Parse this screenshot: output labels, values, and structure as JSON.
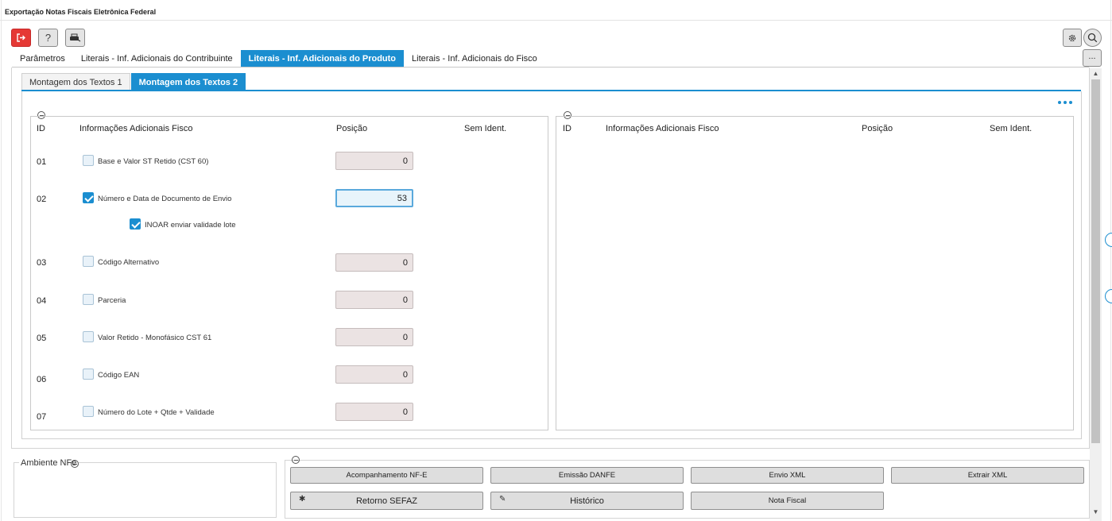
{
  "window": {
    "title": "Exportação Notas Fiscais Eletrônica Federal"
  },
  "toolbar": {
    "exit": "exit-icon",
    "help_label": "?",
    "print": "print-icon",
    "settings": "gear-icon",
    "search": "search-icon",
    "more_label": "..."
  },
  "main_tabs": [
    {
      "label": "Parâmetros"
    },
    {
      "label": "Literais - Inf. Adicionais do Contribuinte"
    },
    {
      "label": "Literais - Inf. Adicionais do Produto"
    },
    {
      "label": "Literais - Inf. Adicionais do Fisco"
    }
  ],
  "active_main_tab": 2,
  "sub_tabs": [
    {
      "label": "Montagem dos Textos 1"
    },
    {
      "label": "Montagem dos Textos 2"
    }
  ],
  "active_sub_tab": 1,
  "left_grid": {
    "headers": {
      "id": "ID",
      "info": "Informações Adicionais Fisco",
      "pos": "Posição",
      "sem": "Sem Ident."
    },
    "rows": [
      {
        "id": "01",
        "label": "Base e Valor ST Retido (CST 60)",
        "checked": false,
        "value": "0"
      },
      {
        "id": "02",
        "label": "Número e Data de Documento de Envio",
        "checked": true,
        "value": "53"
      },
      {
        "id": "03",
        "label": "Código Alternativo",
        "checked": false,
        "value": "0"
      },
      {
        "id": "04",
        "label": "Parceria",
        "checked": false,
        "value": "0"
      },
      {
        "id": "05",
        "label": "Valor Retido - Monofásico CST 61",
        "checked": false,
        "value": "0"
      },
      {
        "id": "06",
        "label": "Código EAN",
        "checked": false,
        "value": "0"
      },
      {
        "id": "07",
        "label": "Número do Lote + Qtde + Validade",
        "checked": false,
        "value": "0"
      }
    ],
    "sub_option": {
      "label": "INOAR enviar validade lote",
      "checked": true
    }
  },
  "right_grid": {
    "headers": {
      "id": "ID",
      "info": "Informações Adicionais Fisco",
      "pos": "Posição",
      "sem": "Sem Ident."
    }
  },
  "ambiente": {
    "legend": "Ambiente NFe"
  },
  "actions": [
    {
      "label": "Acompanhamento NF-E",
      "icon": ""
    },
    {
      "label": "Emissão DANFE",
      "icon": ""
    },
    {
      "label": "Envio XML",
      "icon": ""
    },
    {
      "label": "Extrair XML",
      "icon": ""
    },
    {
      "label": "Retorno SEFAZ",
      "icon": "gear-icon"
    },
    {
      "label": "Histórico",
      "icon": "edit-icon"
    },
    {
      "label": "Nota Fiscal",
      "icon": ""
    }
  ],
  "colors": {
    "accent": "#1b8ed0",
    "exit": "#e53935"
  }
}
